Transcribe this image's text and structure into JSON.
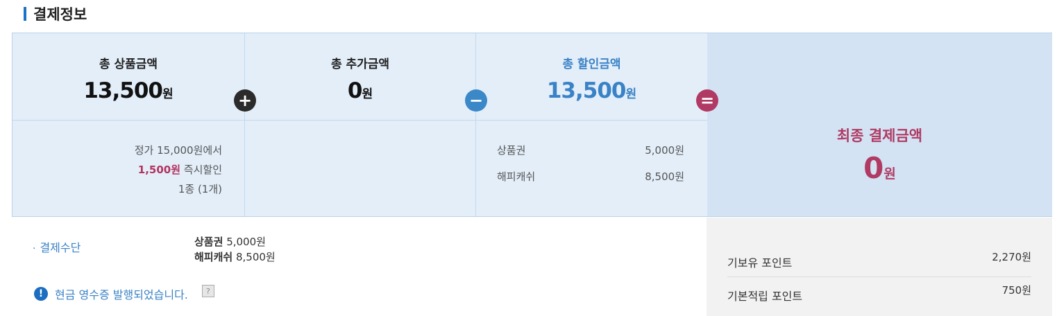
{
  "section_title": "결제정보",
  "summary": {
    "product": {
      "head": "총 상품금액",
      "amount": "13,500",
      "unit": "원",
      "detail_line1": "정가 15,000원에서",
      "detail_discount": "1,500원",
      "detail_discount_suffix": " 즉시할인",
      "detail_line3": "1종 (1개)"
    },
    "extra": {
      "head": "총 추가금액",
      "amount": "0",
      "unit": "원"
    },
    "discount": {
      "head": "총 할인금액",
      "amount": "13,500",
      "unit": "원",
      "rows": [
        {
          "label": "상품권",
          "value": "5,000원"
        },
        {
          "label": "해피캐쉬",
          "value": "8,500원"
        }
      ]
    },
    "final": {
      "label": "최종 결제금액",
      "amount": "0",
      "unit": "원"
    },
    "operators": {
      "plus": "+",
      "minus": "−",
      "equals": "="
    }
  },
  "payment": {
    "method_label": "결제수단",
    "items": [
      {
        "name": "상품권",
        "value": "5,000원"
      },
      {
        "name": "해피캐쉬",
        "value": "8,500원"
      }
    ],
    "receipt_notice": "현금 영수증 발행되었습니다.",
    "help_icon_text": "?"
  },
  "points": {
    "rows": [
      {
        "label": "기보유 포인트",
        "value": "2,270원"
      },
      {
        "label": "기본적립 포인트",
        "value": "750원"
      }
    ]
  },
  "colors": {
    "accent_blue": "#3a82c6",
    "accent_red": "#b03a63",
    "panel_bg": "#e3eef9",
    "final_bg": "#d3e3f3"
  },
  "icons": {
    "info": "info-icon",
    "help": "help-icon"
  }
}
